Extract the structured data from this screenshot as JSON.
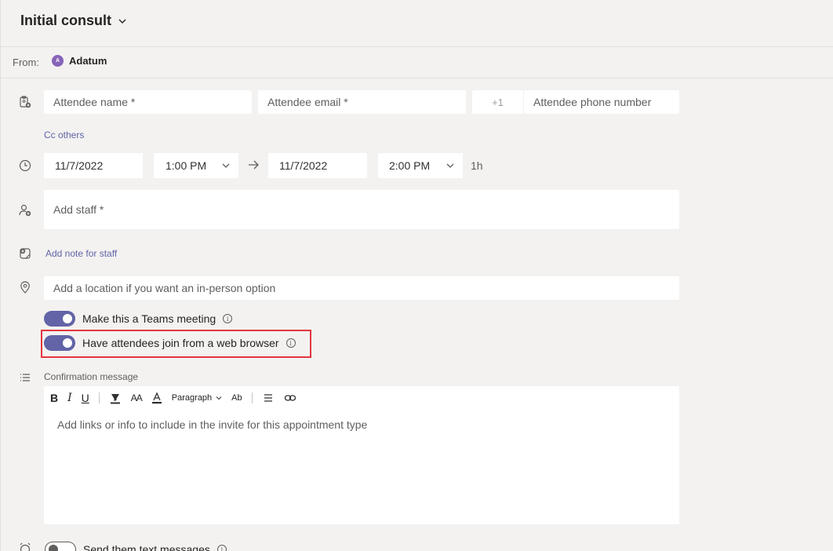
{
  "header": {
    "title": "Initial consult"
  },
  "from": {
    "label": "From:",
    "avatar_initial": "A",
    "org": "Adatum"
  },
  "attendee": {
    "name_placeholder": "Attendee name *",
    "email_placeholder": "Attendee email *",
    "country_code": "+1",
    "phone_placeholder": "Attendee phone number",
    "cc_link": "Cc others"
  },
  "datetime": {
    "start_date": "11/7/2022",
    "start_time": "1:00 PM",
    "end_date": "11/7/2022",
    "end_time": "2:00 PM",
    "duration": "1h"
  },
  "staff": {
    "placeholder": "Add staff *",
    "note_link": "Add note for staff"
  },
  "location": {
    "placeholder": "Add a location if you want an in-person option"
  },
  "toggles": {
    "teams_meeting": {
      "label": "Make this a Teams meeting",
      "on": true
    },
    "web_browser": {
      "label": "Have attendees join from a web browser",
      "on": true
    },
    "text_messages": {
      "label": "Send them text messages",
      "on": false
    }
  },
  "confirmation": {
    "label": "Confirmation message",
    "toolbar": {
      "bold": "B",
      "italic": "I",
      "underline": "U",
      "font_size": "AA",
      "paragraph": "Paragraph",
      "clear_format": "Ab"
    },
    "placeholder": "Add links or info to include in the invite for this appointment type"
  },
  "colors": {
    "accent": "#6264a7",
    "highlight": "#e3363f",
    "background": "#f3f2f1"
  }
}
